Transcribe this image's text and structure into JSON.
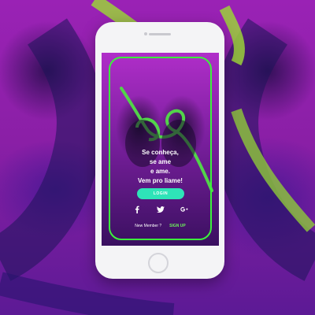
{
  "screen": {
    "tagline_lines": [
      "Se conheça,",
      "se ame",
      "e ame.",
      "Vem pro liame!"
    ],
    "login_label": "LOGIN",
    "social_icons": [
      "facebook-icon",
      "twitter-icon",
      "google-plus-icon"
    ],
    "new_member_text": "New Member ?",
    "signup_label": "SIGN UP"
  },
  "colors": {
    "frame": "#3cf23c",
    "login_button": "#2ee3b8",
    "signup_link": "#6cf25a",
    "background": "#8a1fa6"
  }
}
